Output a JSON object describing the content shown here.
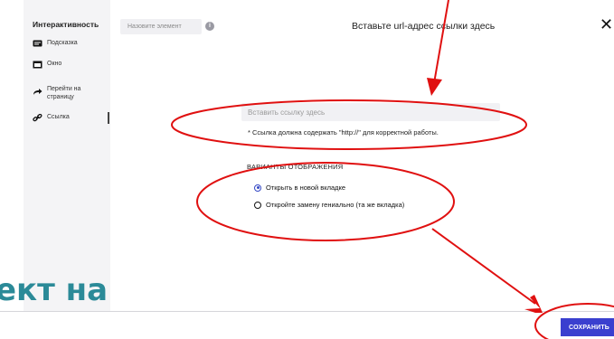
{
  "sidebar": {
    "title": "Интерактивность",
    "items": [
      {
        "label": "Подсказка",
        "icon": "tooltip-icon"
      },
      {
        "label": "Окно",
        "icon": "window-icon"
      },
      {
        "label": "Перейти на страницу",
        "icon": "arrow-forward-icon"
      },
      {
        "label": "Ссылка",
        "icon": "link-icon"
      }
    ]
  },
  "header": {
    "name_placeholder": "Назовите элемент",
    "title": "Вставьте url-адрес ссылки здесь"
  },
  "link": {
    "placeholder": "Вставить ссылку здесь",
    "note": "* Ссылка должна содержать \"http://\" для корректной работы."
  },
  "display": {
    "label": "ВАРИАНТЫ ОТОБРАЖЕНИЯ",
    "options": [
      {
        "label": "Открыть в новой вкладке",
        "selected": true
      },
      {
        "label": "Откройте замену гениально (та же вкладка)",
        "selected": false
      }
    ]
  },
  "footer": {
    "save_label": "СОХРАНИТЬ"
  },
  "overlay": {
    "text": "ект на"
  },
  "colors": {
    "annotation": "#e01010",
    "accent": "#3a3fcf",
    "overlay_text": "#2b8a98"
  }
}
